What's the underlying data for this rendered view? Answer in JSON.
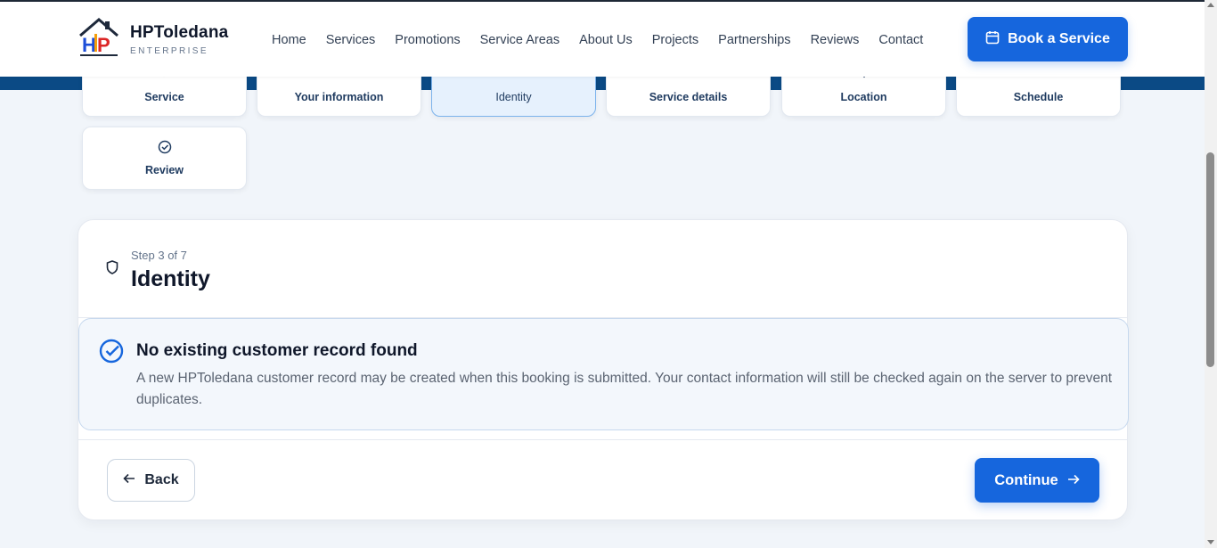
{
  "brand": {
    "name": "HPToledana",
    "subtitle": "ENTERPRISE",
    "logo_text": "HP"
  },
  "nav": {
    "items": [
      {
        "label": "Home"
      },
      {
        "label": "Services"
      },
      {
        "label": "Promotions"
      },
      {
        "label": "Service Areas"
      },
      {
        "label": "About Us"
      },
      {
        "label": "Projects"
      },
      {
        "label": "Partnerships"
      },
      {
        "label": "Reviews"
      },
      {
        "label": "Contact"
      }
    ],
    "cta_label": "Book a Service"
  },
  "steps": [
    {
      "label": "Service",
      "icon": "check-icon"
    },
    {
      "label": "Your information",
      "icon": "user-icon"
    },
    {
      "label": "Identity",
      "icon": "shield-icon",
      "active": true
    },
    {
      "label": "Service details",
      "icon": "clipboard-icon"
    },
    {
      "label": "Location",
      "icon": "map-pin-icon"
    },
    {
      "label": "Schedule",
      "icon": "calendar-icon"
    },
    {
      "label": "Review",
      "icon": "check-circle-icon"
    }
  ],
  "card": {
    "step_of": "Step 3 of 7",
    "title": "Identity",
    "notice_title": "No existing customer record found",
    "notice_body": "A new HPToledana customer record may be created when this booking is submitted. Your contact information will still be checked again on the server to prevent duplicates.",
    "back_label": "Back",
    "continue_label": "Continue"
  },
  "colors": {
    "primary": "#1666dd",
    "band": "#0b4a85",
    "active_step_bg": "#e6f1fd"
  }
}
